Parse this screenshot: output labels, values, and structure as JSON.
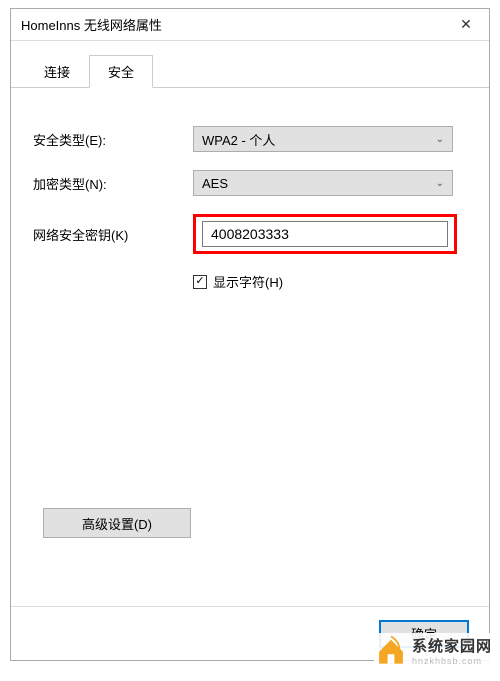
{
  "window": {
    "title": "HomeInns 无线网络属性",
    "close_symbol": "✕"
  },
  "tabs": {
    "connection": "连接",
    "security": "安全"
  },
  "form": {
    "security_type_label": "安全类型(E):",
    "security_type_value": "WPA2 - 个人",
    "encryption_type_label": "加密类型(N):",
    "encryption_type_value": "AES",
    "network_key_label": "网络安全密钥(K)",
    "network_key_value": "4008203333",
    "show_chars_label": "显示字符(H)",
    "show_chars_checked": "✓"
  },
  "buttons": {
    "advanced": "高级设置(D)",
    "ok": "确定"
  },
  "watermark": {
    "text": "系统家园网",
    "url": "hnzkhbsb.com"
  }
}
